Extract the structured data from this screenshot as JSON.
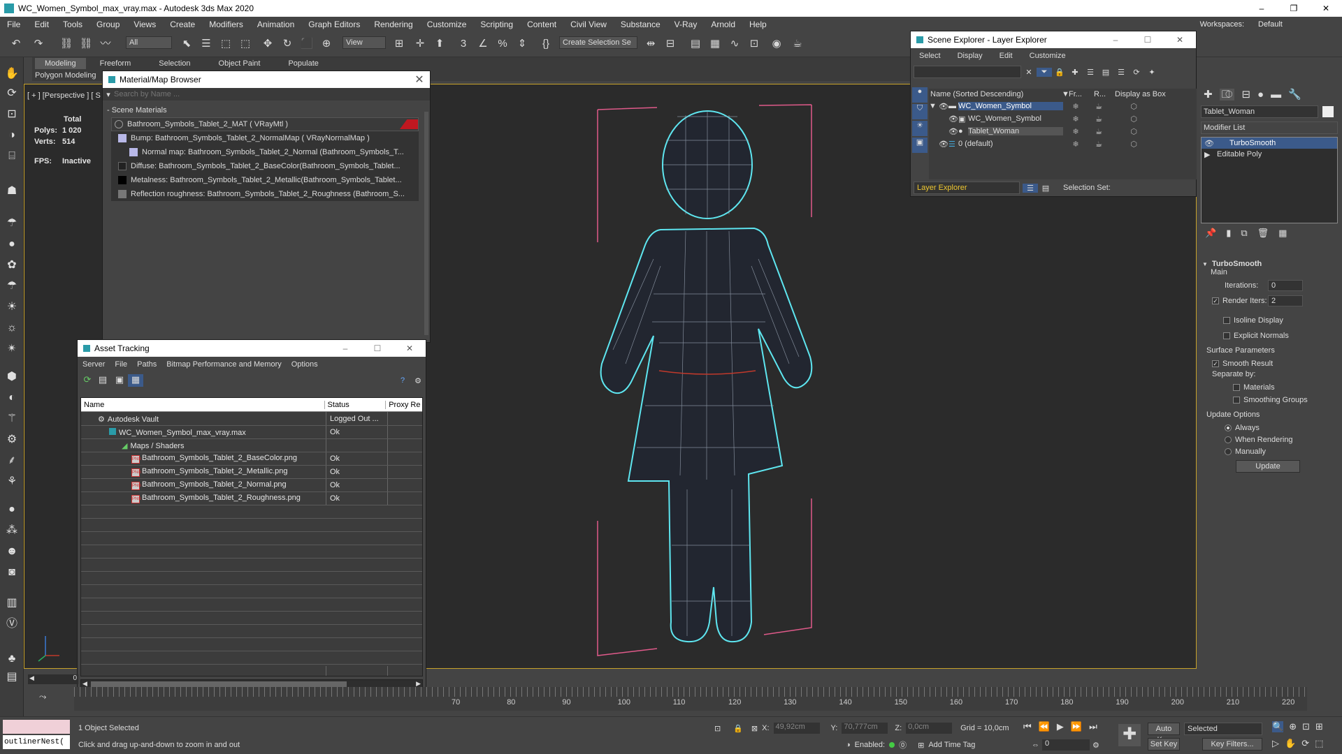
{
  "window": {
    "title": "WC_Women_Symbol_max_vray.max - Autodesk 3ds Max 2020"
  },
  "menu": [
    "File",
    "Edit",
    "Tools",
    "Group",
    "Views",
    "Create",
    "Modifiers",
    "Animation",
    "Graph Editors",
    "Rendering",
    "Customize",
    "Scripting",
    "Content",
    "Civil View",
    "Substance",
    "V-Ray",
    "Arnold",
    "Help"
  ],
  "workspaces": {
    "label": "Workspaces:",
    "value": "Default"
  },
  "toolbar": {
    "filter": "All",
    "view": "View",
    "selection_set": "Create Selection Se"
  },
  "ribbon": {
    "tabs": [
      "Modeling",
      "Freeform",
      "Selection",
      "Object Paint",
      "Populate"
    ],
    "sub": "Polygon Modeling"
  },
  "viewport": {
    "label": "[ + ] [Perspective ] [ S",
    "stats": {
      "total": "Total",
      "polys_label": "Polys:",
      "polys": "1 020",
      "verts_label": "Verts:",
      "verts": "514",
      "fps_label": "FPS:",
      "fps": "Inactive"
    }
  },
  "material_browser": {
    "title": "Material/Map Browser",
    "search_placeholder": "Search by Name ...",
    "section": "- Scene Materials",
    "items": [
      "Bathroom_Symbols_Tablet_2_MAT ( VRayMtl )",
      "Bump: Bathroom_Symbols_Tablet_2_NormalMap ( VRayNormalMap )",
      "Normal map: Bathroom_Symbols_Tablet_2_Normal (Bathroom_Symbols_T...",
      "Diffuse: Bathroom_Symbols_Tablet_2_BaseColor(Bathroom_Symbols_Tablet...",
      "Metalness: Bathroom_Symbols_Tablet_2_Metallic(Bathroom_Symbols_Tablet...",
      "Reflection roughness: Bathroom_Symbols_Tablet_2_Roughness (Bathroom_S..."
    ]
  },
  "asset_tracking": {
    "title": "Asset Tracking",
    "menu": [
      "Server",
      "File",
      "Paths",
      "Bitmap Performance and Memory",
      "Options"
    ],
    "columns": [
      "Name",
      "Status",
      "Proxy Re"
    ],
    "rows": [
      {
        "name": "Autodesk Vault",
        "status": "Logged Out ..."
      },
      {
        "name": "WC_Women_Symbol_max_vray.max",
        "status": "Ok"
      },
      {
        "name": "Maps / Shaders",
        "status": ""
      },
      {
        "name": "Bathroom_Symbols_Tablet_2_BaseColor.png",
        "status": "Ok"
      },
      {
        "name": "Bathroom_Symbols_Tablet_2_Metallic.png",
        "status": "Ok"
      },
      {
        "name": "Bathroom_Symbols_Tablet_2_Normal.png",
        "status": "Ok"
      },
      {
        "name": "Bathroom_Symbols_Tablet_2_Roughness.png",
        "status": "Ok"
      }
    ]
  },
  "scene_explorer": {
    "title": "Scene Explorer - Layer Explorer",
    "menu": [
      "Select",
      "Display",
      "Edit",
      "Customize"
    ],
    "columns": [
      "Name (Sorted Descending)",
      "Fr...",
      "R...",
      "Display as Box"
    ],
    "rows": [
      "WC_Women_Symbol",
      "WC_Women_Symbol",
      "Tablet_Woman",
      "0 (default)"
    ],
    "footer_dropdown": "Layer Explorer",
    "selection_set": "Selection Set:"
  },
  "command_panel": {
    "object_name": "Tablet_Woman",
    "modifier_list": "Modifier List",
    "stack": [
      "TurboSmooth",
      "Editable Poly"
    ],
    "rollout": "TurboSmooth",
    "main": "Main",
    "iterations_label": "Iterations:",
    "iterations": "0",
    "render_iters_label": "Render Iters:",
    "render_iters": "2",
    "isoline": "Isoline Display",
    "explicit": "Explicit Normals",
    "surface": "Surface Parameters",
    "smooth_result": "Smooth Result",
    "separate": "Separate by:",
    "materials": "Materials",
    "smoothing": "Smoothing Groups",
    "update_options": "Update Options",
    "always": "Always",
    "when_rendering": "When Rendering",
    "manually": "Manually",
    "update": "Update"
  },
  "timeline": {
    "ticks": [
      "70",
      "80",
      "90",
      "100",
      "110",
      "120",
      "130",
      "140",
      "150",
      "160",
      "170",
      "180",
      "190",
      "200",
      "210",
      "220"
    ],
    "frame": "0"
  },
  "status": {
    "script": "outlinerNest(",
    "selected": "1 Object Selected",
    "prompt": "Click and drag up-and-down to zoom in and out",
    "x_label": "X:",
    "x": "49,92cm",
    "y_label": "Y:",
    "y": "70,777cm",
    "z_label": "Z:",
    "z": "0,0cm",
    "grid": "Grid = 10,0cm",
    "enabled": "Enabled:",
    "add_time_tag": "Add Time Tag",
    "auto_key": "Auto Key",
    "auto_key_mode": "Selected",
    "set_key": "Set Key",
    "key_filters": "Key Filters...",
    "frame": "0"
  },
  "colors": {
    "accent": "#3b5a8a",
    "wire": "#5ee6f0",
    "bbox": "#e05a8a"
  }
}
